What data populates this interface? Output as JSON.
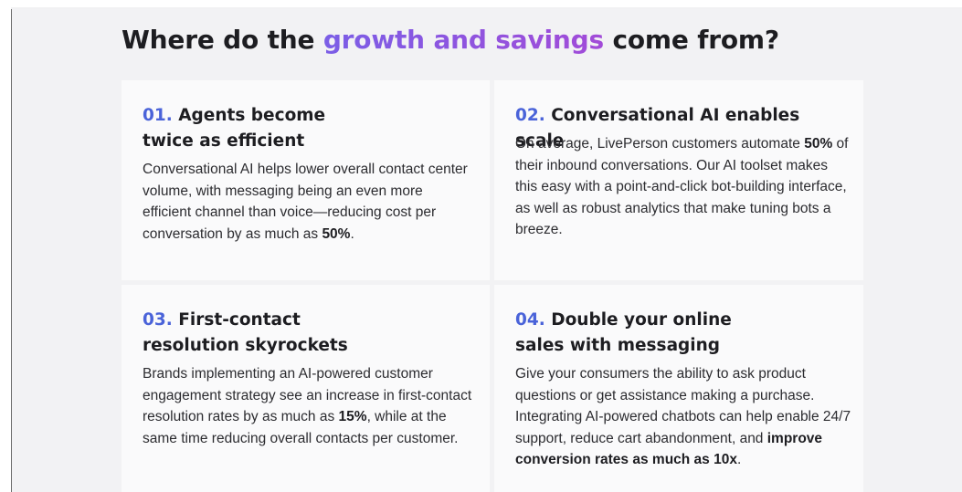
{
  "headline": {
    "prefix": "Where do the ",
    "accent": "growth and savings",
    "suffix": " come from?"
  },
  "cards": [
    {
      "number": "01.",
      "title_line1": "Agents become",
      "title_line2": "twice as efficient",
      "body": [
        {
          "t": "Conversational AI helps lower overall contact center volume, with messaging being an even more efficient channel than voice—reducing cost per conversation by as much as ",
          "b": false
        },
        {
          "t": "50%",
          "b": true
        },
        {
          "t": ".",
          "b": false
        }
      ]
    },
    {
      "number": "02.",
      "title_line1": "Conversational AI enables scale",
      "title_line2": "",
      "body": [
        {
          "t": "On average, LivePerson customers automate ",
          "b": false
        },
        {
          "t": "50%",
          "b": true
        },
        {
          "t": " of their inbound conversations. Our AI toolset makes this easy with a point-and-click bot-building interface, as well as robust analytics that make tuning bots a breeze.",
          "b": false
        }
      ]
    },
    {
      "number": "03.",
      "title_line1": "First-contact",
      "title_line2": "resolution skyrockets",
      "body": [
        {
          "t": "Brands implementing an AI-powered customer engagement strategy see an increase in first-contact resolution rates by as much as ",
          "b": false
        },
        {
          "t": "15%",
          "b": true
        },
        {
          "t": ", while at the same time reducing overall contacts per customer.",
          "b": false
        }
      ]
    },
    {
      "number": "04.",
      "title_line1": "Double your online",
      "title_line2": "sales with messaging",
      "body": [
        {
          "t": "Give your consumers the ability to ask product questions or get assistance making a purchase. Integrating AI-powered chatbots can help enable 24/7 support, reduce cart abandonment, and ",
          "b": false
        },
        {
          "t": "improve conversion rates as much as 10x",
          "b": true
        },
        {
          "t": ".",
          "b": false
        }
      ]
    }
  ]
}
